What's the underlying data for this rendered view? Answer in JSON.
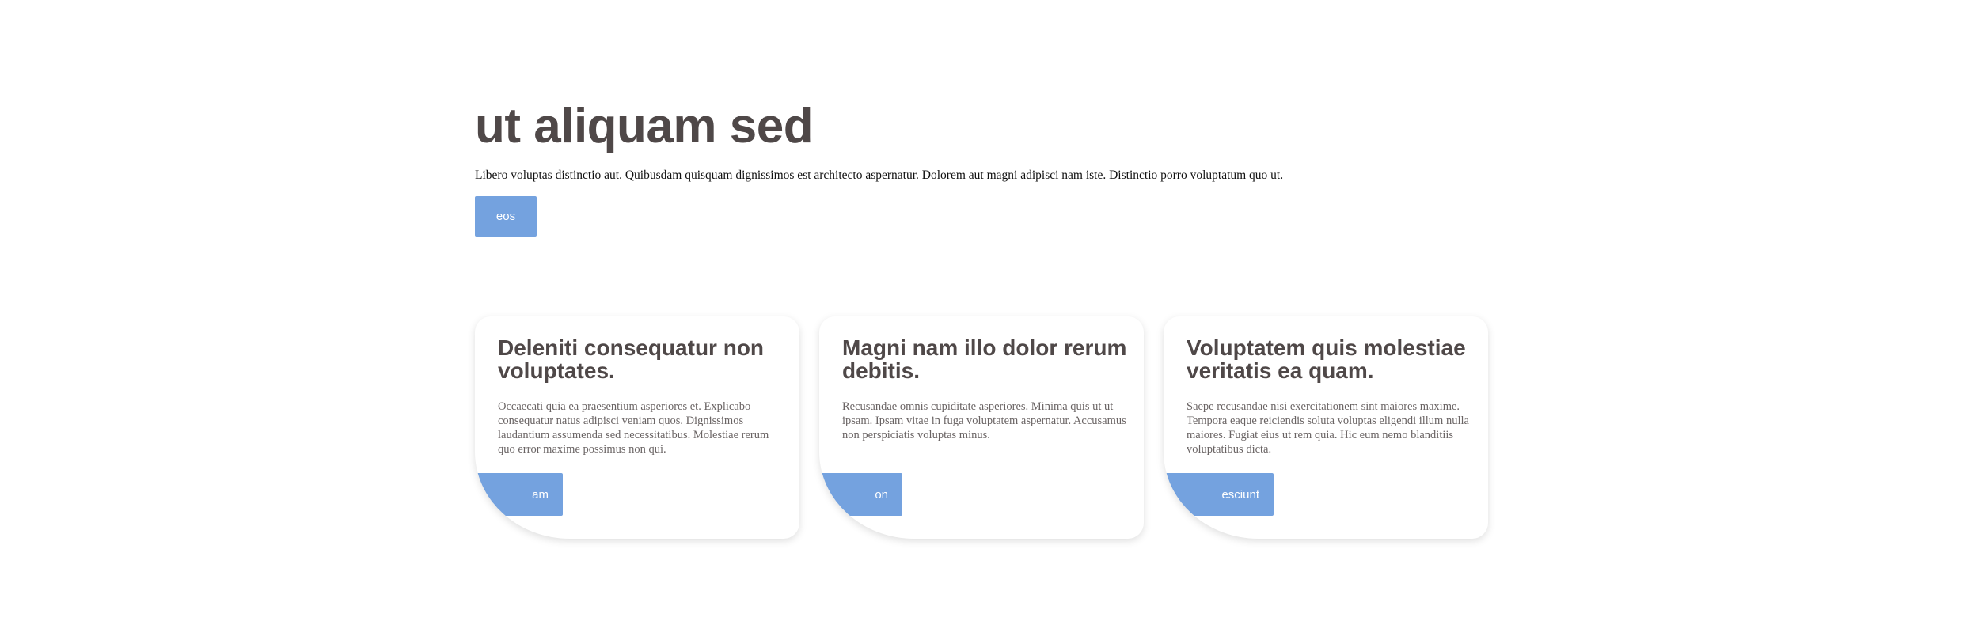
{
  "hero": {
    "title": "ut aliquam sed",
    "description": "Libero voluptas distinctio aut. Quibusdam quisquam dignissimos est architecto aspernatur. Dolorem aut magni adipisci nam iste. Distinctio porro voluptatum quo ut.",
    "button_label": "eos"
  },
  "cards": [
    {
      "title": "Deleniti consequatur non voluptates.",
      "description": "Occaecati quia ea praesentium asperiores et. Explicabo consequatur natus adipisci veniam quos. Dignissimos laudantium assumenda sed necessitatibus. Molestiae rerum quo error maxime possimus non qui.",
      "button_label": "am"
    },
    {
      "title": "Magni nam illo dolor rerum debitis.",
      "description": "Recusandae omnis cupiditate asperiores. Minima quis ut ut ipsam. Ipsam vitae in fuga voluptatem aspernatur. Accusamus non perspiciatis voluptas minus.",
      "button_label": "on"
    },
    {
      "title": "Voluptatem quis molestiae veritatis ea quam.",
      "description": "Saepe recusandae nisi exercitationem sint maiores maxime. Tempora eaque reiciendis soluta voluptas eligendi illum nulla maiores. Fugiat eius ut rem quia. Hic eum nemo blanditiis voluptatibus dicta.",
      "button_label": "esciunt"
    }
  ],
  "colors": {
    "accent": "#74a2df",
    "heading": "#4f4848",
    "body_text": "#6a6464"
  }
}
